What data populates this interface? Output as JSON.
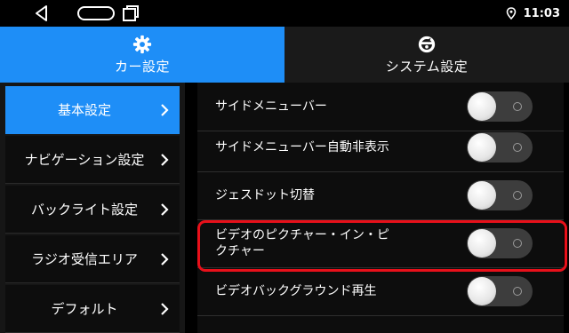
{
  "status": {
    "time": "11:03"
  },
  "tabs": [
    {
      "label": "カー設定",
      "icon": "gear-icon"
    },
    {
      "label": "システム設定",
      "icon": "system-settings-icon"
    }
  ],
  "sidebar": {
    "items": [
      {
        "label": "基本設定"
      },
      {
        "label": "ナビゲーション設定"
      },
      {
        "label": "バックライト設定"
      },
      {
        "label": "ラジオ受信エリア"
      },
      {
        "label": "デフォルト"
      }
    ]
  },
  "settings": [
    {
      "label": "サイドメニューバー",
      "state": "off"
    },
    {
      "label": "サイドメニューバー自動非表示",
      "state": "off"
    },
    {
      "label": "ジェスドット切替",
      "state": "off"
    },
    {
      "label_line1": "ビデオのピクチャー・イン・ピ",
      "label_line2": "クチャー",
      "state": "off",
      "highlighted": true
    },
    {
      "label": "ビデオバックグラウンド再生",
      "state": "off"
    }
  ],
  "colors": {
    "accent": "#1e8ef7",
    "highlight": "#e8101a"
  }
}
